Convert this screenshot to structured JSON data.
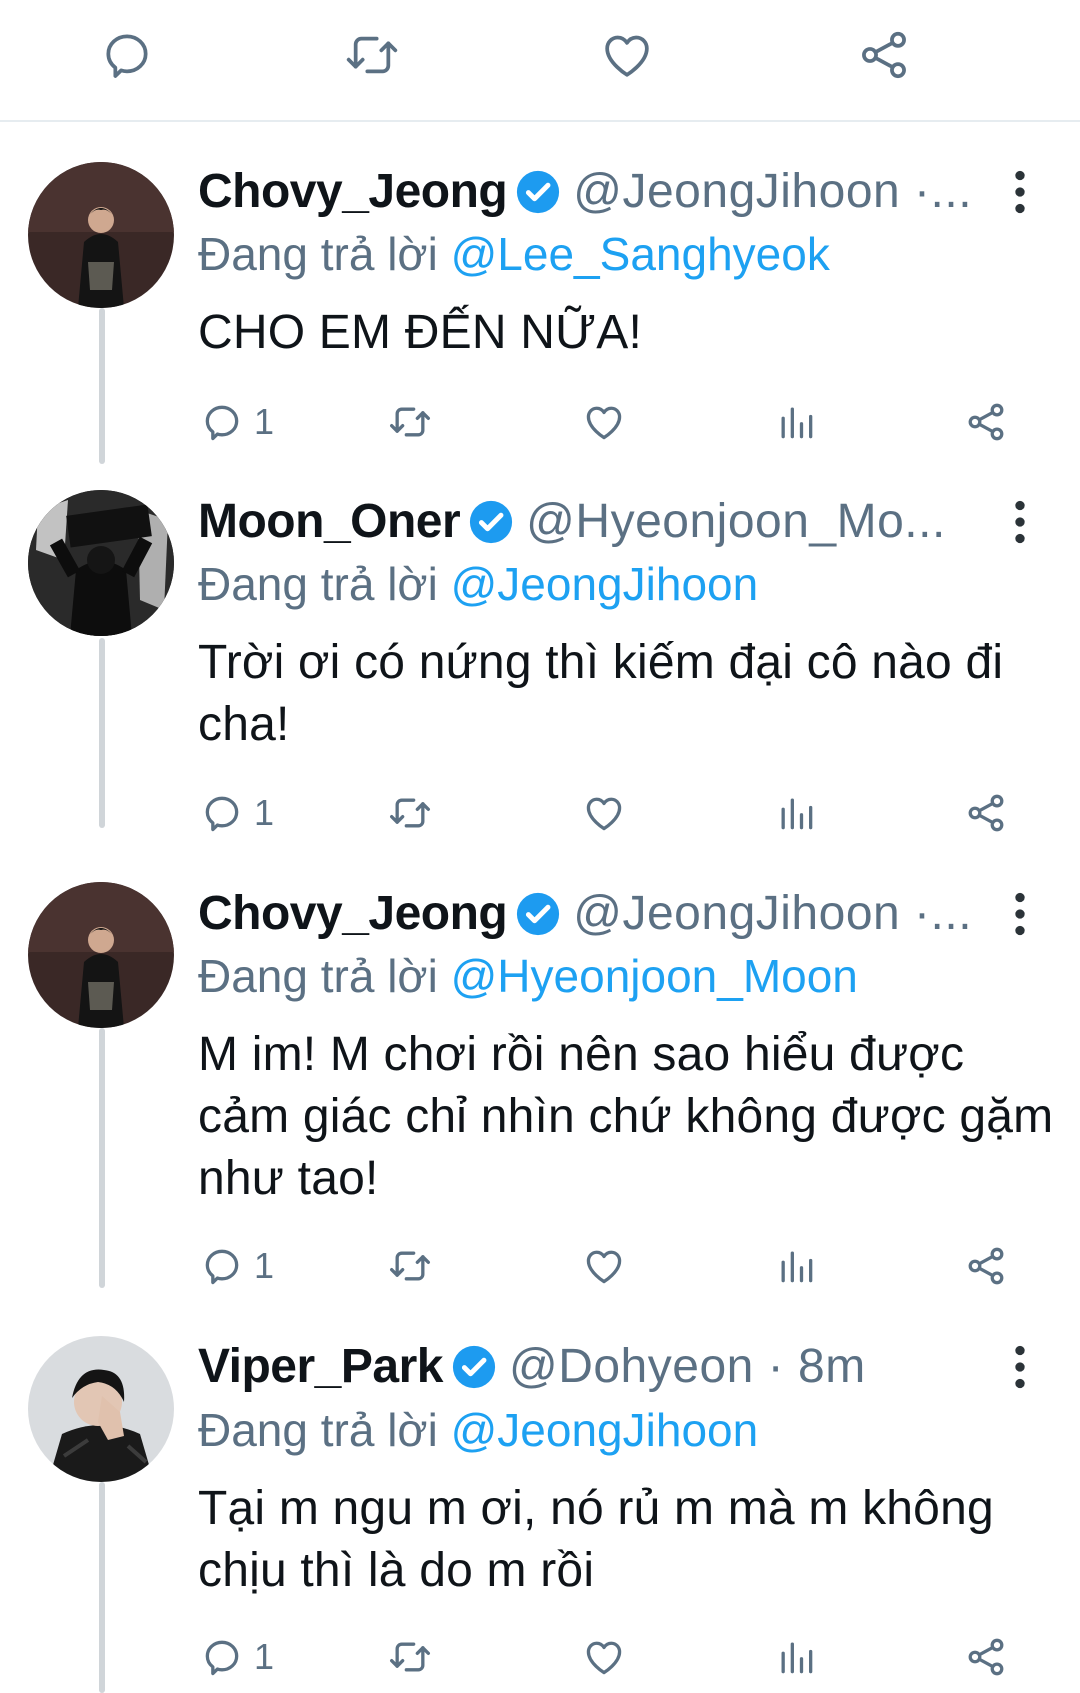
{
  "colors": {
    "accent": "#1da1f2",
    "verified": "#1d9bf0",
    "muted": "#5b7083",
    "text": "#0f1419",
    "thread_line": "#d0d5d9"
  },
  "top_actions": {
    "icons": [
      "reply-icon",
      "retweet-icon",
      "like-icon",
      "share-icon"
    ]
  },
  "tweets": [
    {
      "display_name": "Chovy_Jeong",
      "handle": "@JeongJihoon ·...",
      "reply_prefix": "Đang trả lời ",
      "reply_to": "@Lee_Sanghyeok",
      "text": "CHO EM ĐẾN NỮA!",
      "reply_count": "1"
    },
    {
      "display_name": "Moon_Oner",
      "handle": "@Hyeonjoon_Mo...",
      "reply_prefix": "Đang trả lời ",
      "reply_to": "@JeongJihoon",
      "text": "Trời ơi có nứng thì kiếm đại cô nào đi cha!",
      "reply_count": "1"
    },
    {
      "display_name": "Chovy_Jeong",
      "handle": "@JeongJihoon ·...",
      "reply_prefix": "Đang trả lời ",
      "reply_to": "@Hyeonjoon_Moon",
      "text": "M im! M chơi rồi nên sao hiểu được cảm giác chỉ nhìn chứ không được gặm như tao!",
      "reply_count": "1"
    },
    {
      "display_name": "Viper_Park",
      "handle": "@Dohyeon · 8m",
      "reply_prefix": "Đang trả lời ",
      "reply_to": "@JeongJihoon",
      "text": "Tại m ngu m ơi, nó rủ m mà m không chịu thì là do m rồi",
      "reply_count": "1"
    }
  ]
}
